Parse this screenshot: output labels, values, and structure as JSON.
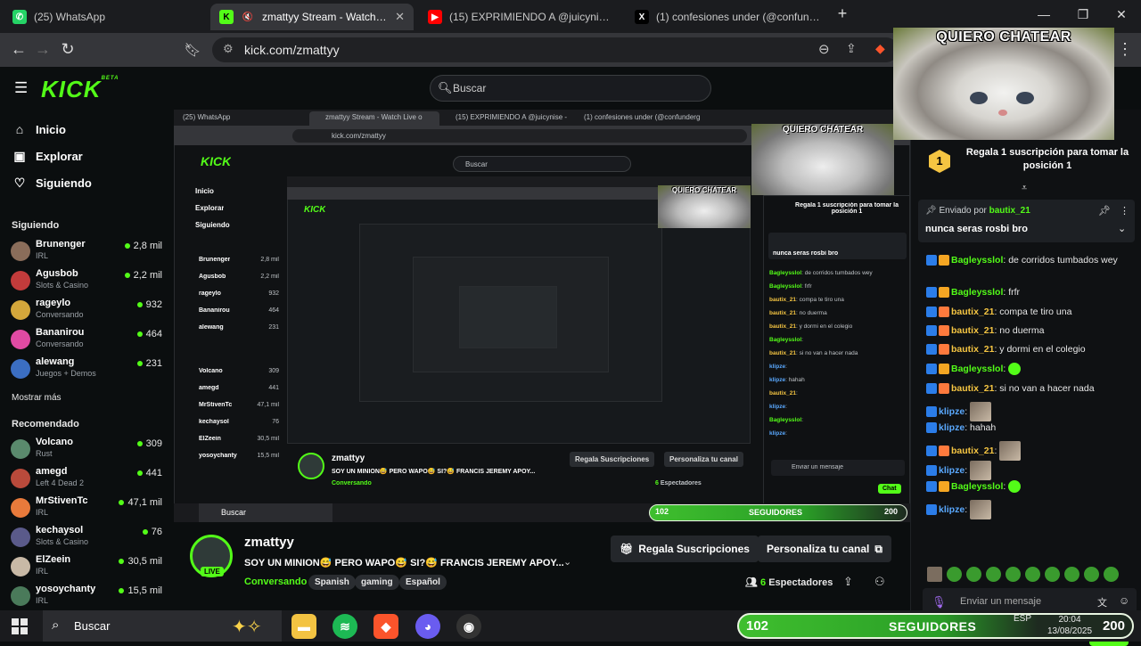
{
  "browser": {
    "tabs": [
      {
        "label": "(25) WhatsApp",
        "favicon": "whatsapp-icon",
        "color": "#25d366"
      },
      {
        "label": "zmattyy Stream - Watch Live o",
        "favicon": "kick-icon",
        "color": "#53fc18"
      },
      {
        "label": "(15) EXPRIMIENDO A @juicynise - Yo",
        "favicon": "youtube-icon",
        "color": "#ff0000"
      },
      {
        "label": "(1) confesiones under (@confunderg",
        "favicon": "x-icon",
        "color": "#000000"
      }
    ],
    "url": "kick.com/zmattyy"
  },
  "kick": {
    "logo": "KICK",
    "logo_sup": "BETA",
    "search_placeholder": "Buscar",
    "accent": "#53fc18"
  },
  "sidebar": {
    "nav": [
      {
        "label": "Inicio",
        "icon": "home-icon"
      },
      {
        "label": "Explorar",
        "icon": "compass-icon"
      },
      {
        "label": "Siguiendo",
        "icon": "heart-icon"
      }
    ],
    "following_title": "Siguiendo",
    "following": [
      {
        "name": "Brunenger",
        "category": "IRL",
        "viewers": "2,8 mil"
      },
      {
        "name": "Agusbob",
        "category": "Slots & Casino",
        "viewers": "2,2 mil"
      },
      {
        "name": "rageylo",
        "category": "Conversando",
        "viewers": "932"
      },
      {
        "name": "Bananirou",
        "category": "Conversando",
        "viewers": "464"
      },
      {
        "name": "alewang",
        "category": "Juegos + Demos",
        "viewers": "231"
      }
    ],
    "show_more": "Mostrar más",
    "recommended_title": "Recomendado",
    "recommended": [
      {
        "name": "Volcano",
        "category": "Rust",
        "viewers": "309"
      },
      {
        "name": "amegd",
        "category": "Left 4 Dead 2",
        "viewers": "441"
      },
      {
        "name": "MrStivenTc",
        "category": "IRL",
        "viewers": "47,1 mil"
      },
      {
        "name": "kechaysol",
        "category": "Slots & Casino",
        "viewers": "76"
      },
      {
        "name": "ElZeein",
        "category": "IRL",
        "viewers": "30,5 mil"
      },
      {
        "name": "yosoychanty",
        "category": "IRL",
        "viewers": "15,5 mil"
      }
    ]
  },
  "stream": {
    "live_badge": "LIVE",
    "channel": "zmattyy",
    "title": "SOY UN MINION😅 PERO WAPO😅 SI?😅 FRANCIS JEREMY APOY...",
    "category": "Conversando",
    "tags": [
      "Spanish",
      "gaming",
      "Español"
    ],
    "gift_button": "Regala Suscripciones",
    "customize_button": "Personaliza tu canal",
    "viewers_count": "6",
    "viewers_label": "Espectadores"
  },
  "chat": {
    "gift_rank": "1",
    "gift_text": "Regala 1 suscripción para tomar la posición 1",
    "pinned_by_prefix": "Enviado por",
    "pinned_by_user": "bautix_21",
    "pinned_message": "nunca seras rosbi bro",
    "messages": [
      {
        "user": "Bagleysslol",
        "text": "de corridos tumbados wey",
        "user_color": "#53fc18"
      },
      {
        "user": "Bagleysslol",
        "text": "frfr",
        "user_color": "#53fc18"
      },
      {
        "user": "bautix_21",
        "text": "compa te tiro una",
        "user_color": "#f5c542"
      },
      {
        "user": "bautix_21",
        "text": "no duerma",
        "user_color": "#f5c542"
      },
      {
        "user": "bautix_21",
        "text": "y dormi en el colegio",
        "user_color": "#f5c542"
      },
      {
        "user": "Bagleysslol",
        "text": "",
        "user_color": "#53fc18"
      },
      {
        "user": "bautix_21",
        "text": "si no van a hacer nada",
        "user_color": "#f5c542"
      },
      {
        "user": "klipze",
        "text": "",
        "user_color": "#5aa9ff"
      },
      {
        "user": "klipze",
        "text": "hahah",
        "user_color": "#5aa9ff"
      },
      {
        "user": "bautix_21",
        "text": "",
        "user_color": "#f5c542"
      },
      {
        "user": "klipze",
        "text": "",
        "user_color": "#5aa9ff"
      },
      {
        "user": "Bagleysslol",
        "text": "",
        "user_color": "#53fc18"
      },
      {
        "user": "klipze",
        "text": "",
        "user_color": "#5aa9ff"
      }
    ],
    "input_placeholder": "Enviar un mensaje",
    "send_button": "Chat"
  },
  "overlay": {
    "cat_caption": "QUIERO CHATEAR",
    "followers_count": "102",
    "followers_label": "SEGUIDORES",
    "followers_goal": "200",
    "followers_progress": 0.51
  },
  "taskbar": {
    "search_placeholder": "Buscar",
    "language": "ESP",
    "time": "20:04",
    "date": "13/08/2025"
  }
}
